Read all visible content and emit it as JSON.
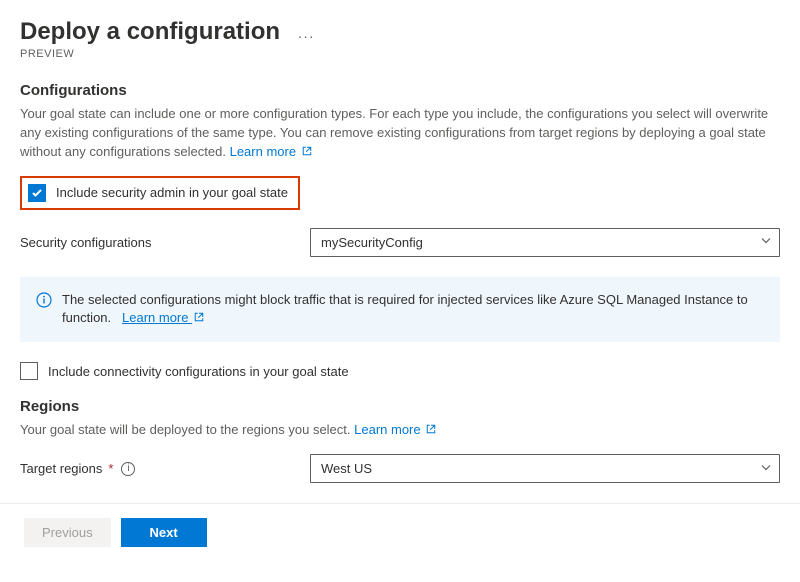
{
  "header": {
    "title": "Deploy a configuration",
    "preview_tag": "PREVIEW"
  },
  "configurations": {
    "heading": "Configurations",
    "description": "Your goal state can include one or more configuration types. For each type you include, the configurations you select will overwrite any existing configurations of the same type. You can remove existing configurations from target regions by deploying a goal state without any configurations selected.",
    "learn_more": "Learn more",
    "include_security_label": "Include security admin in your goal state",
    "security_config_label": "Security configurations",
    "security_config_value": "mySecurityConfig",
    "banner_text": "The selected configurations might block traffic that is required for injected services like Azure SQL Managed Instance to function.",
    "banner_learn_more": "Learn more",
    "include_connectivity_label": "Include connectivity configurations in your goal state"
  },
  "regions": {
    "heading": "Regions",
    "description": "Your goal state will be deployed to the regions you select.",
    "learn_more": "Learn more",
    "target_label": "Target regions",
    "target_value": "West US"
  },
  "buttons": {
    "previous": "Previous",
    "next": "Next"
  }
}
